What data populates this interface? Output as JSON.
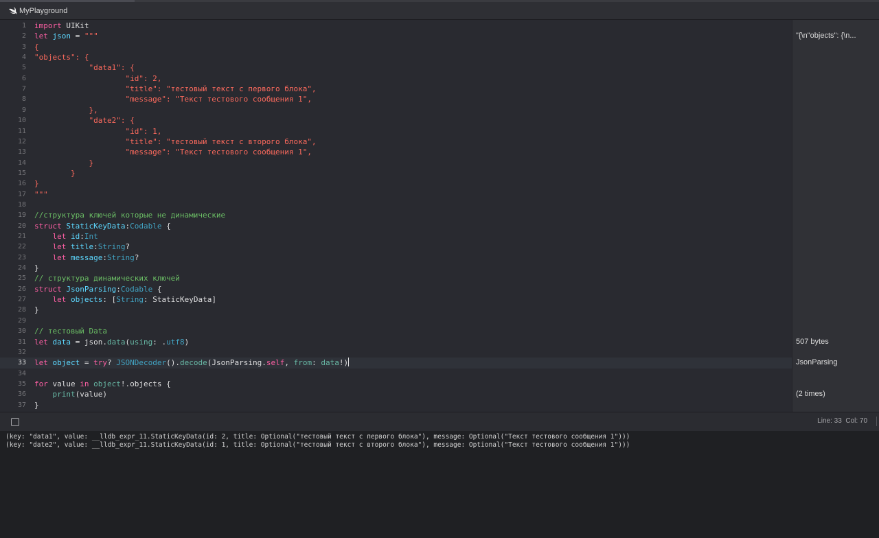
{
  "tab": {
    "title": "MyPlayground",
    "icon": "swift-icon"
  },
  "colors": {
    "keyword": "#fc5fa3",
    "string": "#fc6a5d",
    "comment": "#6bbe65",
    "type": "#5dd8ff",
    "project_type": "#41a1c0",
    "function": "#67b7a4",
    "plain": "#dfdfe0"
  },
  "editor": {
    "current_line": 33,
    "lines": [
      {
        "n": "1",
        "t": [
          [
            "keyword",
            "import"
          ],
          [
            "plain",
            " UIKit"
          ]
        ]
      },
      {
        "n": "2",
        "t": [
          [
            "keyword",
            "let"
          ],
          [
            "plain",
            " "
          ],
          [
            "type",
            "json"
          ],
          [
            "plain",
            " = "
          ],
          [
            "string",
            "\"\"\""
          ]
        ]
      },
      {
        "n": "3",
        "t": [
          [
            "string",
            "{"
          ]
        ]
      },
      {
        "n": "4",
        "t": [
          [
            "string",
            "\"objects\": {"
          ]
        ]
      },
      {
        "n": "5",
        "t": [
          [
            "string",
            "            \"data1\": {"
          ]
        ]
      },
      {
        "n": "6",
        "t": [
          [
            "string",
            "                    \"id\": 2,"
          ]
        ]
      },
      {
        "n": "7",
        "t": [
          [
            "string",
            "                    \"title\": \"тестовый текст с первого блока\","
          ]
        ]
      },
      {
        "n": "8",
        "t": [
          [
            "string",
            "                    \"message\": \"Текст тестового сообщения 1\","
          ]
        ]
      },
      {
        "n": "9",
        "t": [
          [
            "string",
            "            },"
          ]
        ]
      },
      {
        "n": "10",
        "t": [
          [
            "string",
            "            \"date2\": {"
          ]
        ]
      },
      {
        "n": "11",
        "t": [
          [
            "string",
            "                    \"id\": 1,"
          ]
        ]
      },
      {
        "n": "12",
        "t": [
          [
            "string",
            "                    \"title\": \"тестовый текст с второго блока\","
          ]
        ]
      },
      {
        "n": "13",
        "t": [
          [
            "string",
            "                    \"message\": \"Текст тестового сообщения 1\","
          ]
        ]
      },
      {
        "n": "14",
        "t": [
          [
            "string",
            "            }"
          ]
        ]
      },
      {
        "n": "15",
        "t": [
          [
            "string",
            "        }"
          ]
        ]
      },
      {
        "n": "16",
        "t": [
          [
            "string",
            "}"
          ]
        ]
      },
      {
        "n": "17",
        "t": [
          [
            "string",
            "\"\"\""
          ]
        ]
      },
      {
        "n": "18",
        "t": []
      },
      {
        "n": "19",
        "t": [
          [
            "comment",
            "//структура ключей которые не динамические"
          ]
        ]
      },
      {
        "n": "20",
        "t": [
          [
            "keyword",
            "struct"
          ],
          [
            "plain",
            " "
          ],
          [
            "type",
            "StaticKeyData"
          ],
          [
            "plain",
            ":"
          ],
          [
            "project_type",
            "Codable"
          ],
          [
            "plain",
            " {"
          ]
        ]
      },
      {
        "n": "21",
        "t": [
          [
            "plain",
            "    "
          ],
          [
            "keyword",
            "let"
          ],
          [
            "plain",
            " "
          ],
          [
            "type",
            "id"
          ],
          [
            "plain",
            ":"
          ],
          [
            "project_type",
            "Int"
          ]
        ]
      },
      {
        "n": "22",
        "t": [
          [
            "plain",
            "    "
          ],
          [
            "keyword",
            "let"
          ],
          [
            "plain",
            " "
          ],
          [
            "type",
            "title"
          ],
          [
            "plain",
            ":"
          ],
          [
            "project_type",
            "String"
          ],
          [
            "plain",
            "?"
          ]
        ]
      },
      {
        "n": "23",
        "t": [
          [
            "plain",
            "    "
          ],
          [
            "keyword",
            "let"
          ],
          [
            "plain",
            " "
          ],
          [
            "type",
            "message"
          ],
          [
            "plain",
            ":"
          ],
          [
            "project_type",
            "String"
          ],
          [
            "plain",
            "?"
          ]
        ]
      },
      {
        "n": "24",
        "t": [
          [
            "plain",
            "}"
          ]
        ]
      },
      {
        "n": "25",
        "t": [
          [
            "comment",
            "// структура динамических ключей"
          ]
        ]
      },
      {
        "n": "26",
        "t": [
          [
            "keyword",
            "struct"
          ],
          [
            "plain",
            " "
          ],
          [
            "type",
            "JsonParsing"
          ],
          [
            "plain",
            ":"
          ],
          [
            "project_type",
            "Codable"
          ],
          [
            "plain",
            " {"
          ]
        ]
      },
      {
        "n": "27",
        "t": [
          [
            "plain",
            "    "
          ],
          [
            "keyword",
            "let"
          ],
          [
            "plain",
            " "
          ],
          [
            "type",
            "objects"
          ],
          [
            "plain",
            ": ["
          ],
          [
            "project_type",
            "String"
          ],
          [
            "plain",
            ": StaticKeyData]"
          ]
        ]
      },
      {
        "n": "28",
        "t": [
          [
            "plain",
            "}"
          ]
        ]
      },
      {
        "n": "29",
        "t": []
      },
      {
        "n": "30",
        "t": [
          [
            "comment",
            "// тестовый Data"
          ]
        ]
      },
      {
        "n": "31",
        "t": [
          [
            "keyword",
            "let"
          ],
          [
            "plain",
            " "
          ],
          [
            "type",
            "data"
          ],
          [
            "plain",
            " = json."
          ],
          [
            "function",
            "data"
          ],
          [
            "plain",
            "("
          ],
          [
            "function",
            "using"
          ],
          [
            "plain",
            ": ."
          ],
          [
            "project_type",
            "utf8"
          ],
          [
            "plain",
            ")"
          ]
        ]
      },
      {
        "n": "32",
        "t": []
      },
      {
        "n": "33",
        "t": [
          [
            "keyword",
            "let"
          ],
          [
            "plain",
            " "
          ],
          [
            "type",
            "object"
          ],
          [
            "plain",
            " = "
          ],
          [
            "keyword",
            "try"
          ],
          [
            "plain",
            "? "
          ],
          [
            "project_type",
            "JSONDecoder"
          ],
          [
            "plain",
            "()."
          ],
          [
            "function",
            "decode"
          ],
          [
            "plain",
            "(JsonParsing."
          ],
          [
            "keyword",
            "self"
          ],
          [
            "plain",
            ", "
          ],
          [
            "function",
            "from"
          ],
          [
            "plain",
            ": "
          ],
          [
            "function",
            "data"
          ],
          [
            "plain",
            "!)"
          ]
        ]
      },
      {
        "n": "34",
        "t": []
      },
      {
        "n": "35",
        "t": [
          [
            "keyword",
            "for"
          ],
          [
            "plain",
            " value "
          ],
          [
            "keyword",
            "in"
          ],
          [
            "plain",
            " "
          ],
          [
            "function",
            "object"
          ],
          [
            "plain",
            "!.objects {"
          ]
        ]
      },
      {
        "n": "36",
        "t": [
          [
            "plain",
            "    "
          ],
          [
            "function",
            "print"
          ],
          [
            "plain",
            "(value)"
          ]
        ]
      },
      {
        "n": "37",
        "t": [
          [
            "plain",
            "}"
          ]
        ]
      }
    ]
  },
  "results": [
    {
      "line": 2,
      "text": "\"{\\n\"objects\": {\\n..."
    },
    {
      "line": 31,
      "text": "507 bytes"
    },
    {
      "line": 33,
      "text": "JsonParsing"
    },
    {
      "line": 36,
      "text": "(2 times)"
    }
  ],
  "status": {
    "line_col": "Line: 33  Col: 70"
  },
  "console": {
    "lines": [
      "(key: \"data1\", value: __lldb_expr_11.StaticKeyData(id: 2, title: Optional(\"тестовый текст с первого блока\"), message: Optional(\"Текст тестового сообщения 1\")))",
      "(key: \"date2\", value: __lldb_expr_11.StaticKeyData(id: 1, title: Optional(\"тестовый текст с второго блока\"), message: Optional(\"Текст тестового сообщения 1\")))"
    ]
  }
}
